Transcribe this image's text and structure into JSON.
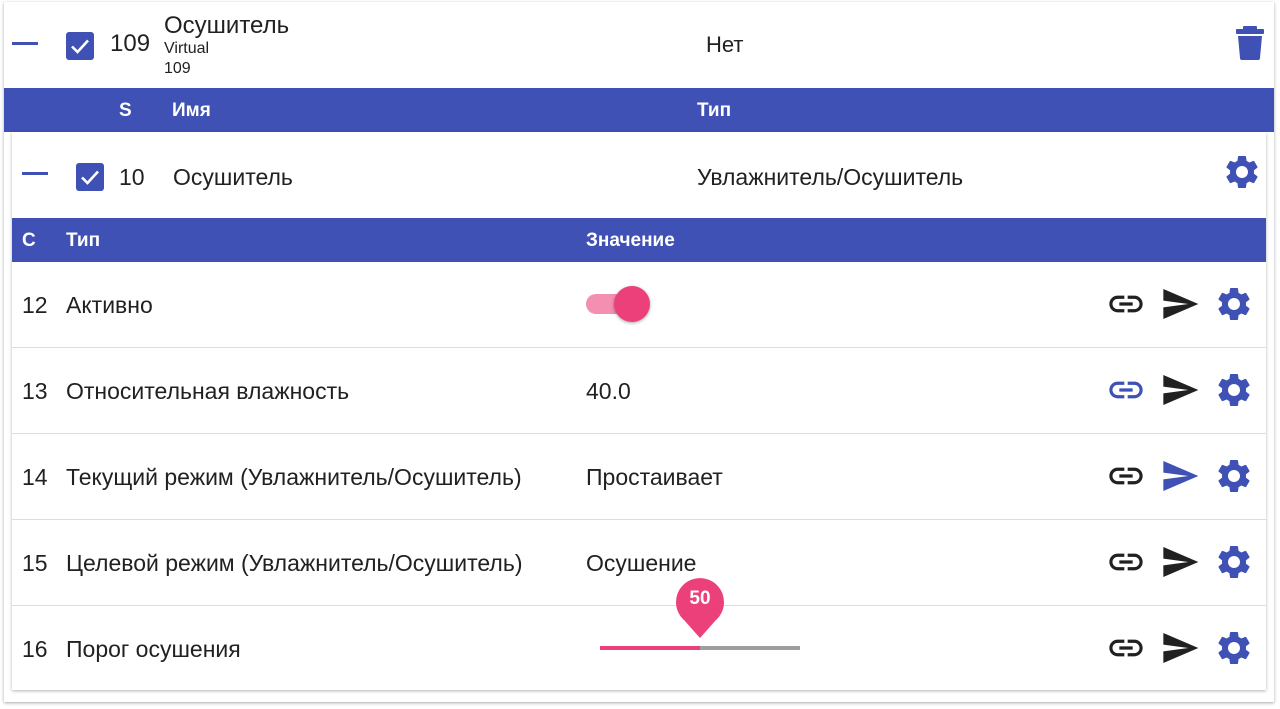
{
  "device": {
    "id": "109",
    "name": "Осушитель",
    "subtitle_line1": "Virtual",
    "subtitle_line2": "109",
    "room": "Нет",
    "checked": true
  },
  "service_header": {
    "col_s": "S",
    "col_name": "Имя",
    "col_type": "Тип"
  },
  "service": {
    "id": "10",
    "name": "Осушитель",
    "type": "Увлажнитель/Осушитель",
    "checked": true
  },
  "props_header": {
    "col_c": "C",
    "col_type": "Тип",
    "col_value": "Значение"
  },
  "properties": [
    {
      "id": "12",
      "name": "Активно",
      "value": "",
      "toggle_on": true,
      "link_color": "#212121",
      "send_color": "#212121"
    },
    {
      "id": "13",
      "name": "Относительная влажность",
      "value": "40.0",
      "link_color": "#3f51b5",
      "send_color": "#212121"
    },
    {
      "id": "14",
      "name": "Текущий режим (Увлажнитель/Осушитель)",
      "value": "Простаивает",
      "link_color": "#212121",
      "send_color": "#3f51b5"
    },
    {
      "id": "15",
      "name": "Целевой режим (Увлажнитель/Осушитель)",
      "value": "Осушение",
      "link_color": "#212121",
      "send_color": "#212121"
    },
    {
      "id": "16",
      "name": "Порог осушения",
      "value": "",
      "slider_value": 50,
      "slider_label": "50",
      "slider_min": 0,
      "slider_max": 100,
      "link_color": "#212121",
      "send_color": "#212121"
    }
  ],
  "icons": {
    "collapse": "minus-icon",
    "checkbox": "checkbox-checked-icon",
    "trash": "trash-icon",
    "settings": "gear-icon",
    "link": "link-icon",
    "send": "send-icon"
  },
  "colors": {
    "primary": "#3f51b5",
    "accent": "#ec407a",
    "accent_light": "#f48fb1"
  }
}
